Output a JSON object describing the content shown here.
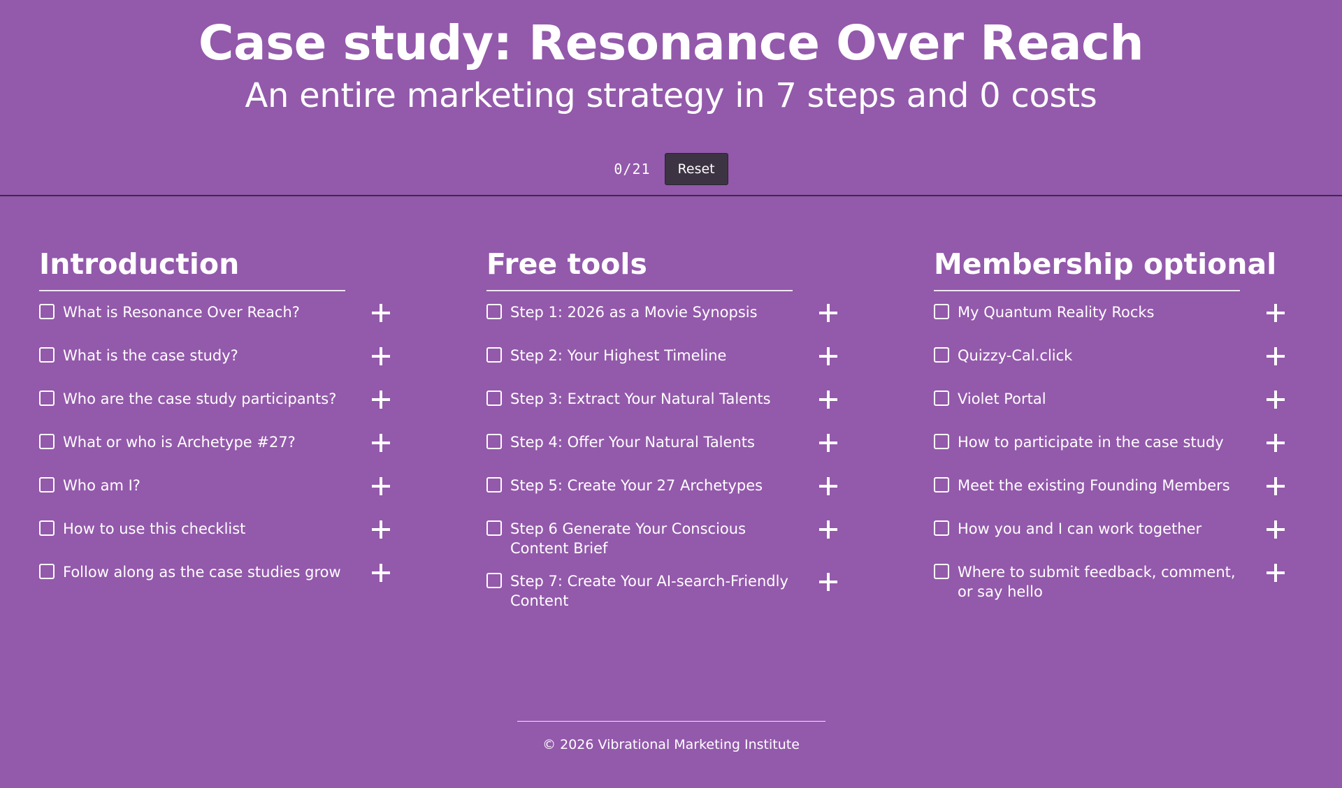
{
  "header": {
    "title": "Case study: Resonance Over Reach",
    "subtitle": "An entire marketing strategy in 7 steps and 0 costs"
  },
  "progress": {
    "counter": "0/21",
    "reset_label": "Reset"
  },
  "sections": [
    {
      "title": "Introduction",
      "items": [
        {
          "label": "What is Resonance Over Reach?"
        },
        {
          "label": "What is the case study?"
        },
        {
          "label": "Who are the case study participants?"
        },
        {
          "label": "What or who is Archetype #27?"
        },
        {
          "label": "Who am I?"
        },
        {
          "label": "How to use this checklist"
        },
        {
          "label": "Follow along as the case studies grow"
        }
      ]
    },
    {
      "title": "Free tools",
      "items": [
        {
          "label": "Step 1: 2026 as a Movie Synopsis"
        },
        {
          "label": "Step 2: Your Highest Timeline"
        },
        {
          "label": "Step 3: Extract Your Natural Talents"
        },
        {
          "label": "Step 4: Offer Your Natural Talents"
        },
        {
          "label": "Step 5: Create Your 27 Archetypes"
        },
        {
          "label": "Step 6 Generate Your Conscious Content Brief"
        },
        {
          "label": "Step 7: Create Your AI-search-Friendly Content"
        }
      ]
    },
    {
      "title": "Membership optional",
      "items": [
        {
          "label": "My Quantum Reality Rocks"
        },
        {
          "label": "Quizzy-Cal.click"
        },
        {
          "label": "Violet Portal"
        },
        {
          "label": "How to participate in the case study"
        },
        {
          "label": "Meet the existing Founding Members"
        },
        {
          "label": "How you and I can work together"
        },
        {
          "label": "Where to submit feedback, comment, or say hello"
        }
      ]
    }
  ],
  "footer": {
    "copyright": "© 2026 Vibrational Marketing Institute"
  },
  "colors": {
    "background": "#9359ab",
    "text": "#ffffff",
    "button": "#3c3343"
  },
  "icons": {
    "expand": "plus-icon"
  }
}
